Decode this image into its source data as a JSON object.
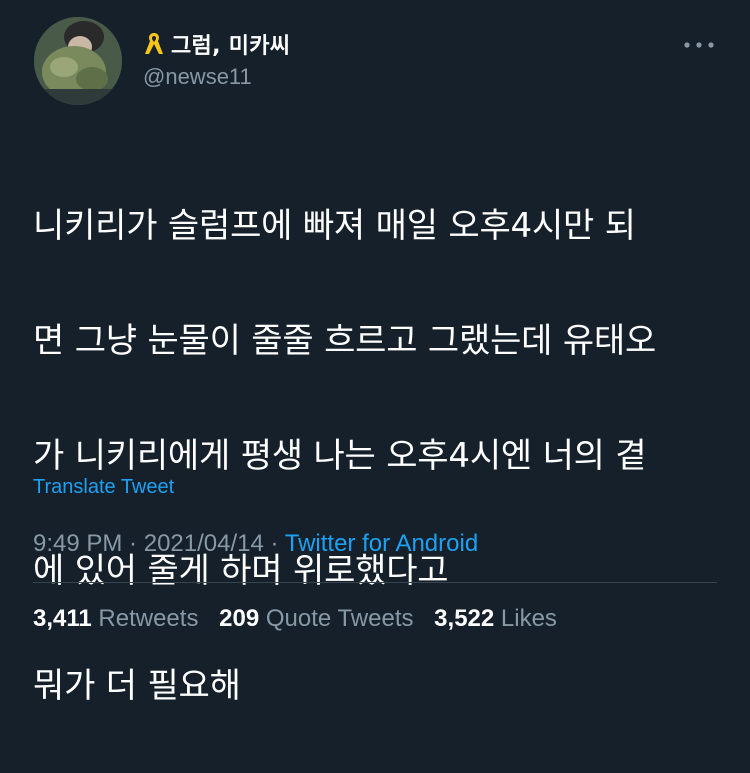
{
  "author": {
    "display_name": "그럼, 미카씨",
    "handle": "@newse11",
    "name_icon": "yellow-ribbon-icon",
    "avatar_alt": "avatar"
  },
  "tweet": {
    "lines": [
      "니키리가 슬럼프에 빠져 매일 오후4시만 되",
      "면 그냥 눈물이 줄줄 흐르고 그랬는데 유태오",
      "가 니키리에게 평생 나는 오후4시엔 너의 곁",
      "에 있어 줄게 하며 위로했다고",
      "뭐가 더 필요해"
    ],
    "translate_label": "Translate Tweet"
  },
  "meta": {
    "time": "9:49 PM",
    "separator1": " · ",
    "date": "2021/04/14",
    "separator2": " · ",
    "source": "Twitter for Android"
  },
  "stats": {
    "retweets_count": "3,411",
    "retweets_label": "Retweets",
    "quotes_count": "209",
    "quotes_label": "Quote Tweets",
    "likes_count": "3,522",
    "likes_label": "Likes"
  },
  "colors": {
    "background": "#15202b",
    "text_primary": "#ffffff",
    "text_secondary": "#8899a6",
    "accent": "#1da1f2",
    "ribbon": "#f5c518",
    "divider": "#38444d"
  },
  "icons": {
    "more": "more-horizontal-icon"
  }
}
